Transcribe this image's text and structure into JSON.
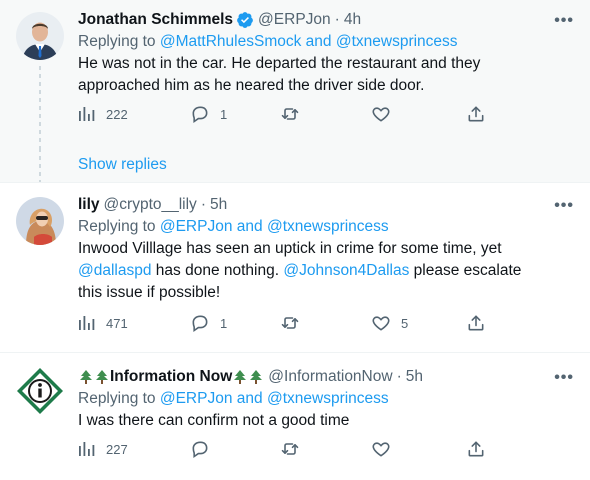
{
  "tweets": [
    {
      "display_name": "Jonathan Schimmels",
      "verified": true,
      "handle": "@ERPJon",
      "separator": "·",
      "time": "4h",
      "reply_prefix": "Replying to",
      "reply_targets": "@MattRhulesSmock and @txnewsprincess",
      "reply_target_1": "@MattRhulesSmock",
      "reply_and": "and",
      "reply_target_2": "@txnewsprincess",
      "text_line1": "He was not in the car. He departed the restaurant and they",
      "text_line2": "approached him as he neared the driver side door.",
      "views": "222",
      "replies": "1",
      "retweets": "",
      "likes": ""
    },
    {
      "display_name": "lily",
      "handle": "@crypto__lily",
      "separator": "·",
      "time": "5h",
      "reply_prefix": "Replying to",
      "reply_target_1": "@ERPJon",
      "reply_and": "and",
      "reply_target_2": "@txnewsprincess",
      "text_a": "Inwood Villlage has seen an uptick in crime for some time, yet",
      "text_mention1": "@dallaspd",
      "text_b": " has done nothing. ",
      "text_mention2": "@Johnson4Dallas",
      "text_c": " please escalate",
      "text_d": "this issue if possible!",
      "views": "471",
      "replies": "1",
      "retweets": "",
      "likes": "5"
    },
    {
      "display_name": "Information Now",
      "handle": "@InformationNow",
      "separator": "·",
      "time": "5h",
      "reply_prefix": "Replying to",
      "reply_target_1": "@ERPJon",
      "reply_and": "and",
      "reply_target_2": "@txnewsprincess",
      "text_line1": "I was there can confirm not a good time",
      "views": "227",
      "replies": "",
      "retweets": "",
      "likes": ""
    }
  ],
  "show_replies_label": "Show replies",
  "more_label": "•••",
  "colors": {
    "accent": "#1d9bf0",
    "secondary_text": "#536471",
    "hover_bg": "#f7f9f9"
  },
  "icons": [
    "analytics-icon",
    "reply-icon",
    "retweet-icon",
    "like-icon",
    "share-icon",
    "verified-badge-icon",
    "more-icon"
  ]
}
